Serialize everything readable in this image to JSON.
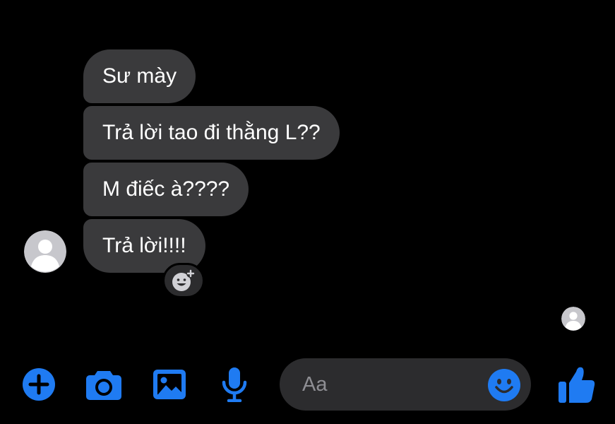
{
  "conversation": {
    "messages": [
      {
        "text": "Sư mày"
      },
      {
        "text": "Trả lời tao đi thằng L??"
      },
      {
        "text": "M điếc à????"
      },
      {
        "text": "Trả lời!!!!"
      }
    ],
    "sender_avatar_icon": "default-user-avatar",
    "seen_avatar_icon": "default-user-avatar",
    "reaction_icon": "add-reaction-icon"
  },
  "composer": {
    "placeholder": "Aa",
    "value": "",
    "emoji_icon": "smiley-icon"
  },
  "toolbar": {
    "icons": [
      "plus-circle-icon",
      "camera-icon",
      "image-icon",
      "microphone-icon"
    ],
    "send_icon": "thumbs-up-icon"
  },
  "colors": {
    "background": "#000000",
    "bubble": "#3a3a3c",
    "accent": "#1f7bf2",
    "composer": "#2c2c2e",
    "placeholder": "#8e8e93"
  }
}
